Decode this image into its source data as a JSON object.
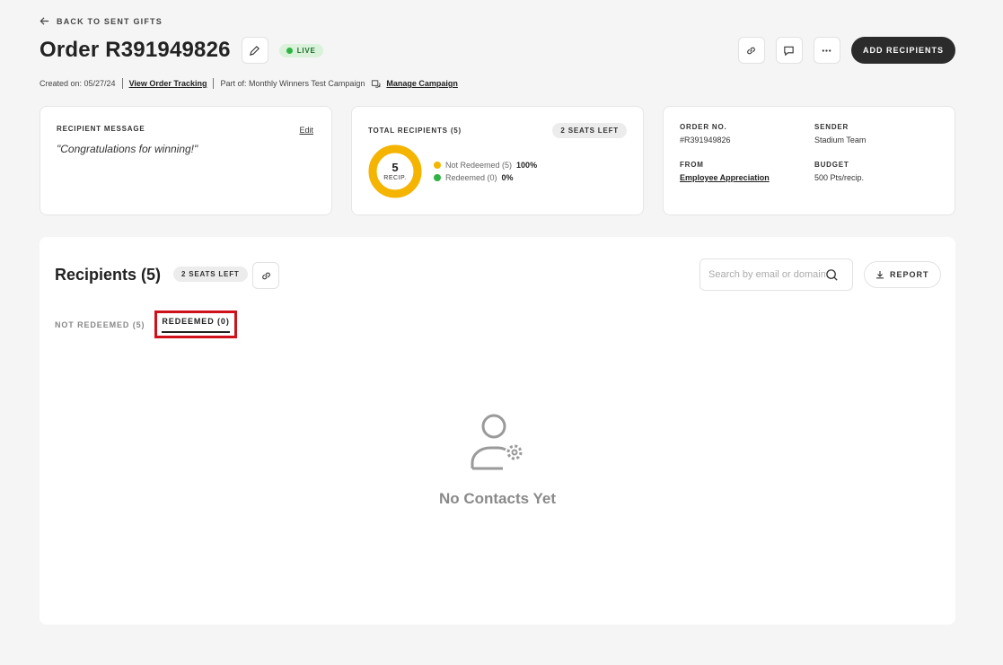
{
  "header": {
    "back_label": "BACK TO SENT GIFTS",
    "title": "Order R391949826",
    "status": "LIVE",
    "add_recipients_label": "ADD RECIPIENTS"
  },
  "meta": {
    "created": "Created on: 05/27/24",
    "view_tracking": "View Order Tracking",
    "part_of": "Part of: Monthly Winners Test Campaign",
    "manage_campaign": "Manage Campaign"
  },
  "message_card": {
    "label": "RECIPIENT MESSAGE",
    "edit_label": "Edit",
    "message": "\"Congratulations for winning!\""
  },
  "recipients_card": {
    "label": "TOTAL RECIPIENTS (5)",
    "seats_left": "2 SEATS LEFT",
    "total": "5",
    "total_unit": "RECIP.",
    "legend": [
      {
        "label": "Not Redeemed (5)",
        "pct": "100%",
        "color": "#f5b400",
        "fraction": 1.0
      },
      {
        "label": "Redeemed (0)",
        "pct": "0%",
        "color": "#2fb344",
        "fraction": 0.0
      }
    ]
  },
  "order_card": {
    "order_no_label": "ORDER NO.",
    "order_no": "#R391949826",
    "sender_label": "SENDER",
    "sender": "Stadium Team",
    "from_label": "FROM",
    "from": "Employee Appreciation",
    "budget_label": "BUDGET",
    "budget": "500 Pts/recip."
  },
  "recipients_panel": {
    "title": "Recipients (5)",
    "seats_left": "2 SEATS LEFT",
    "search_placeholder": "Search by email or domain",
    "report_label": "REPORT",
    "tabs": [
      {
        "label": "NOT REDEEMED (5)"
      },
      {
        "label": "REDEEMED (0)"
      }
    ],
    "empty_text": "No Contacts Yet"
  },
  "colors": {
    "accent_dark": "#2b2b2b",
    "live_bg": "#d9f2d9",
    "donut_primary": "#f5b400",
    "highlight_box": "#d0111b"
  },
  "icons": [
    "arrow-left-icon",
    "pencil-icon",
    "link-icon",
    "comment-icon",
    "more-icon",
    "campaign-icon",
    "search-icon",
    "download-icon",
    "user-gear-icon"
  ]
}
